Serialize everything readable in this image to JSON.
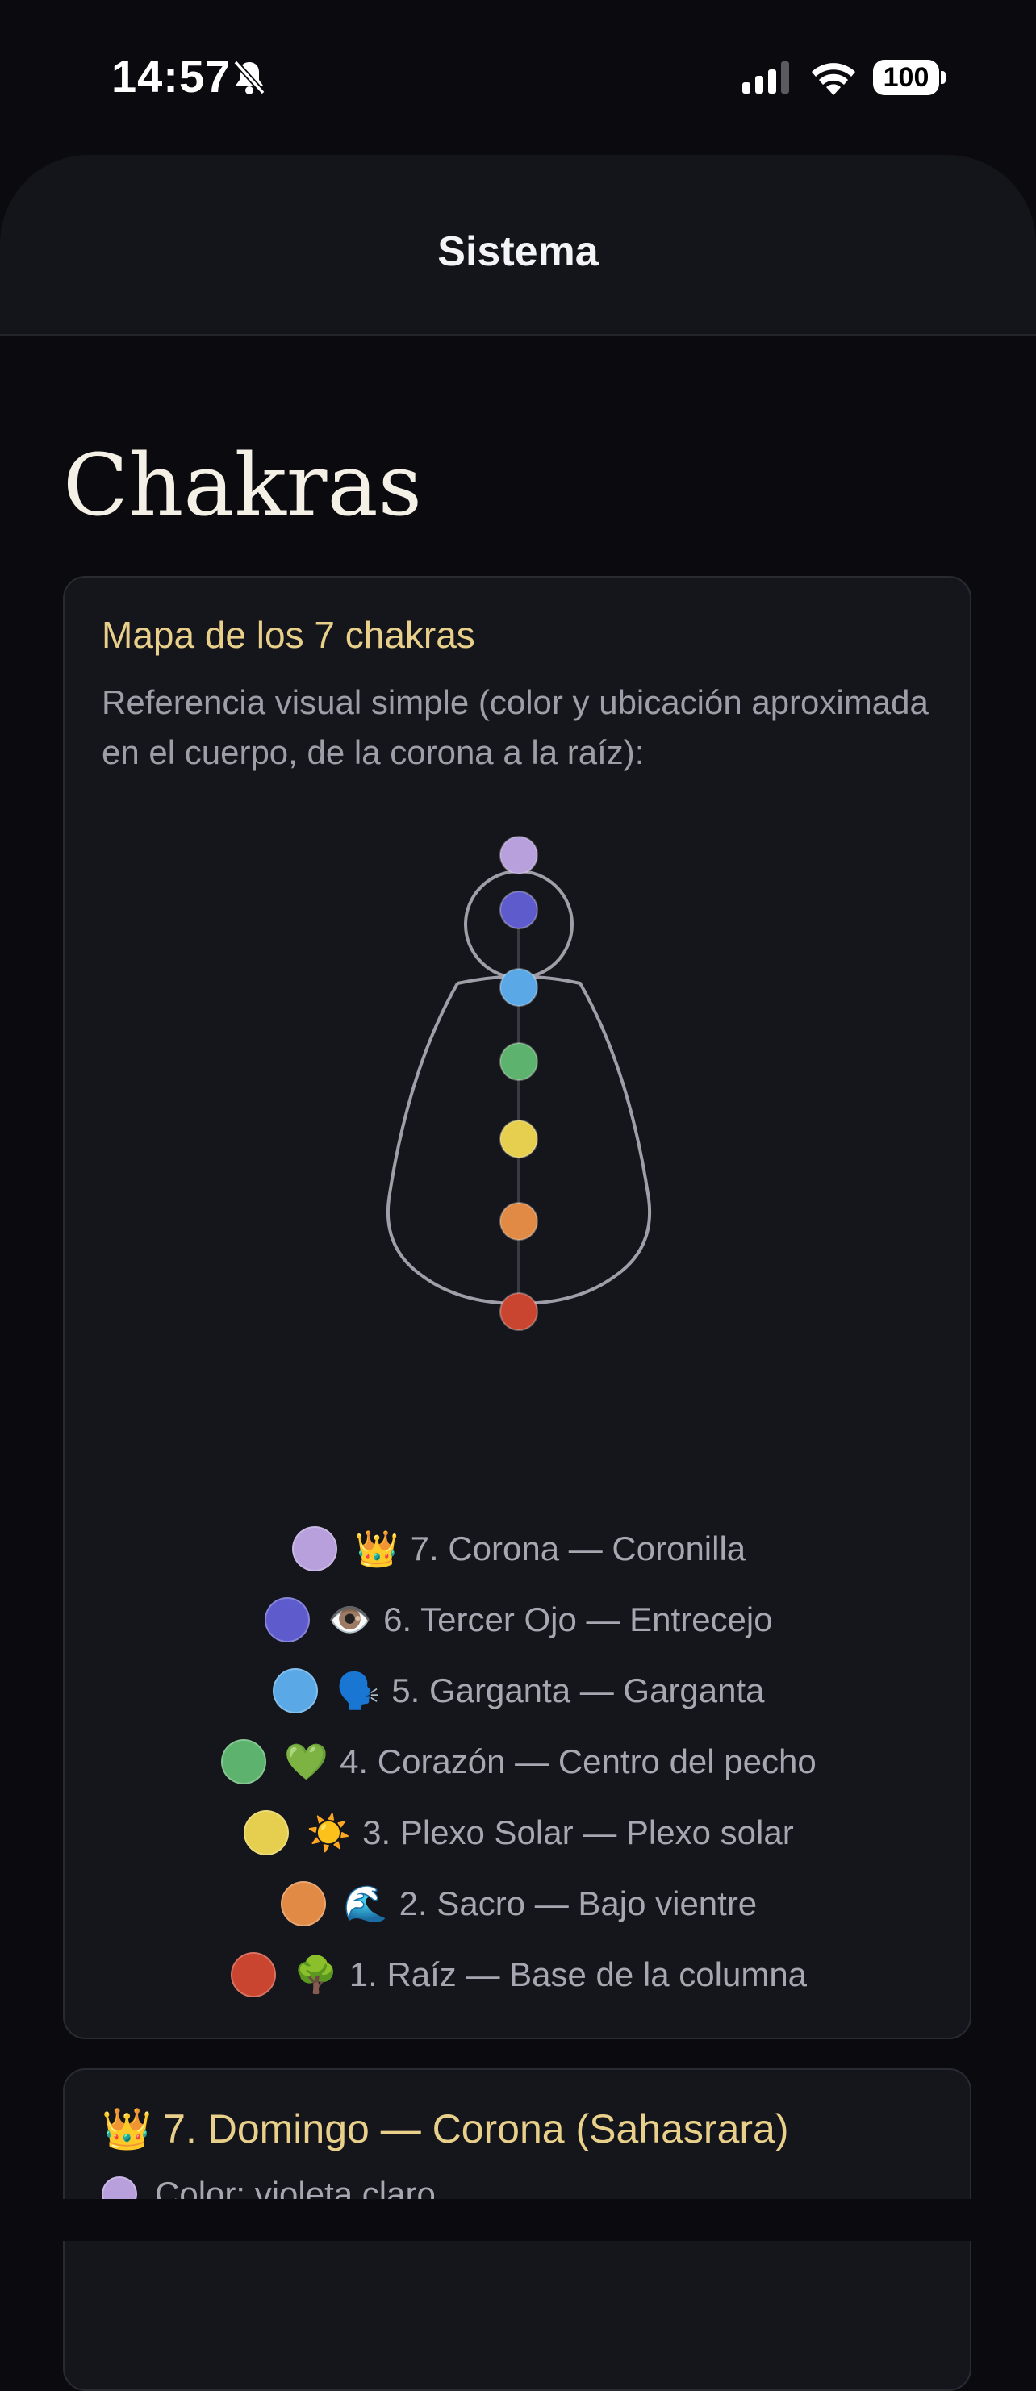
{
  "status_bar": {
    "time": "14:57",
    "battery": "100",
    "icons": [
      "bell-slash-icon",
      "cellular-signal-icon",
      "wifi-icon",
      "battery-icon"
    ]
  },
  "nav": {
    "title": "Sistema"
  },
  "page": {
    "title": "Chakras"
  },
  "map_card": {
    "title": "Mapa de los 7 chakras",
    "description": "Referencia visual simple (color y ubicación aproximada en el cuerpo, de la corona a la raíz):",
    "chakras": [
      {
        "emoji": "👑",
        "label": "7. Corona — Coronilla",
        "color": "#b8a0dc"
      },
      {
        "emoji": "👁️",
        "label": "6. Tercer Ojo — Entrecejo",
        "color": "#5e5ccc"
      },
      {
        "emoji": "🗣️",
        "label": "5. Garganta — Garganta",
        "color": "#5aa9e6"
      },
      {
        "emoji": "💚",
        "label": "4. Corazón — Centro del pecho",
        "color": "#5db36e"
      },
      {
        "emoji": "☀️",
        "label": "3. Plexo Solar — Plexo solar",
        "color": "#e6cf4e"
      },
      {
        "emoji": "🌊",
        "label": "2. Sacro — Bajo vientre",
        "color": "#e08a45"
      },
      {
        "emoji": "🌳",
        "label": "1. Raíz — Base de la columna",
        "color": "#c9452f"
      }
    ]
  },
  "day_card": {
    "title": "👑 7. Domingo — Corona (Sahasrara)",
    "color_label": "Color: violeta claro",
    "color": "#b8a0dc"
  },
  "colors": {
    "background": "#0b0b0f",
    "card": "#15151c",
    "accent_gold": "#e8cf8a",
    "muted_text": "#9e9ea8"
  }
}
